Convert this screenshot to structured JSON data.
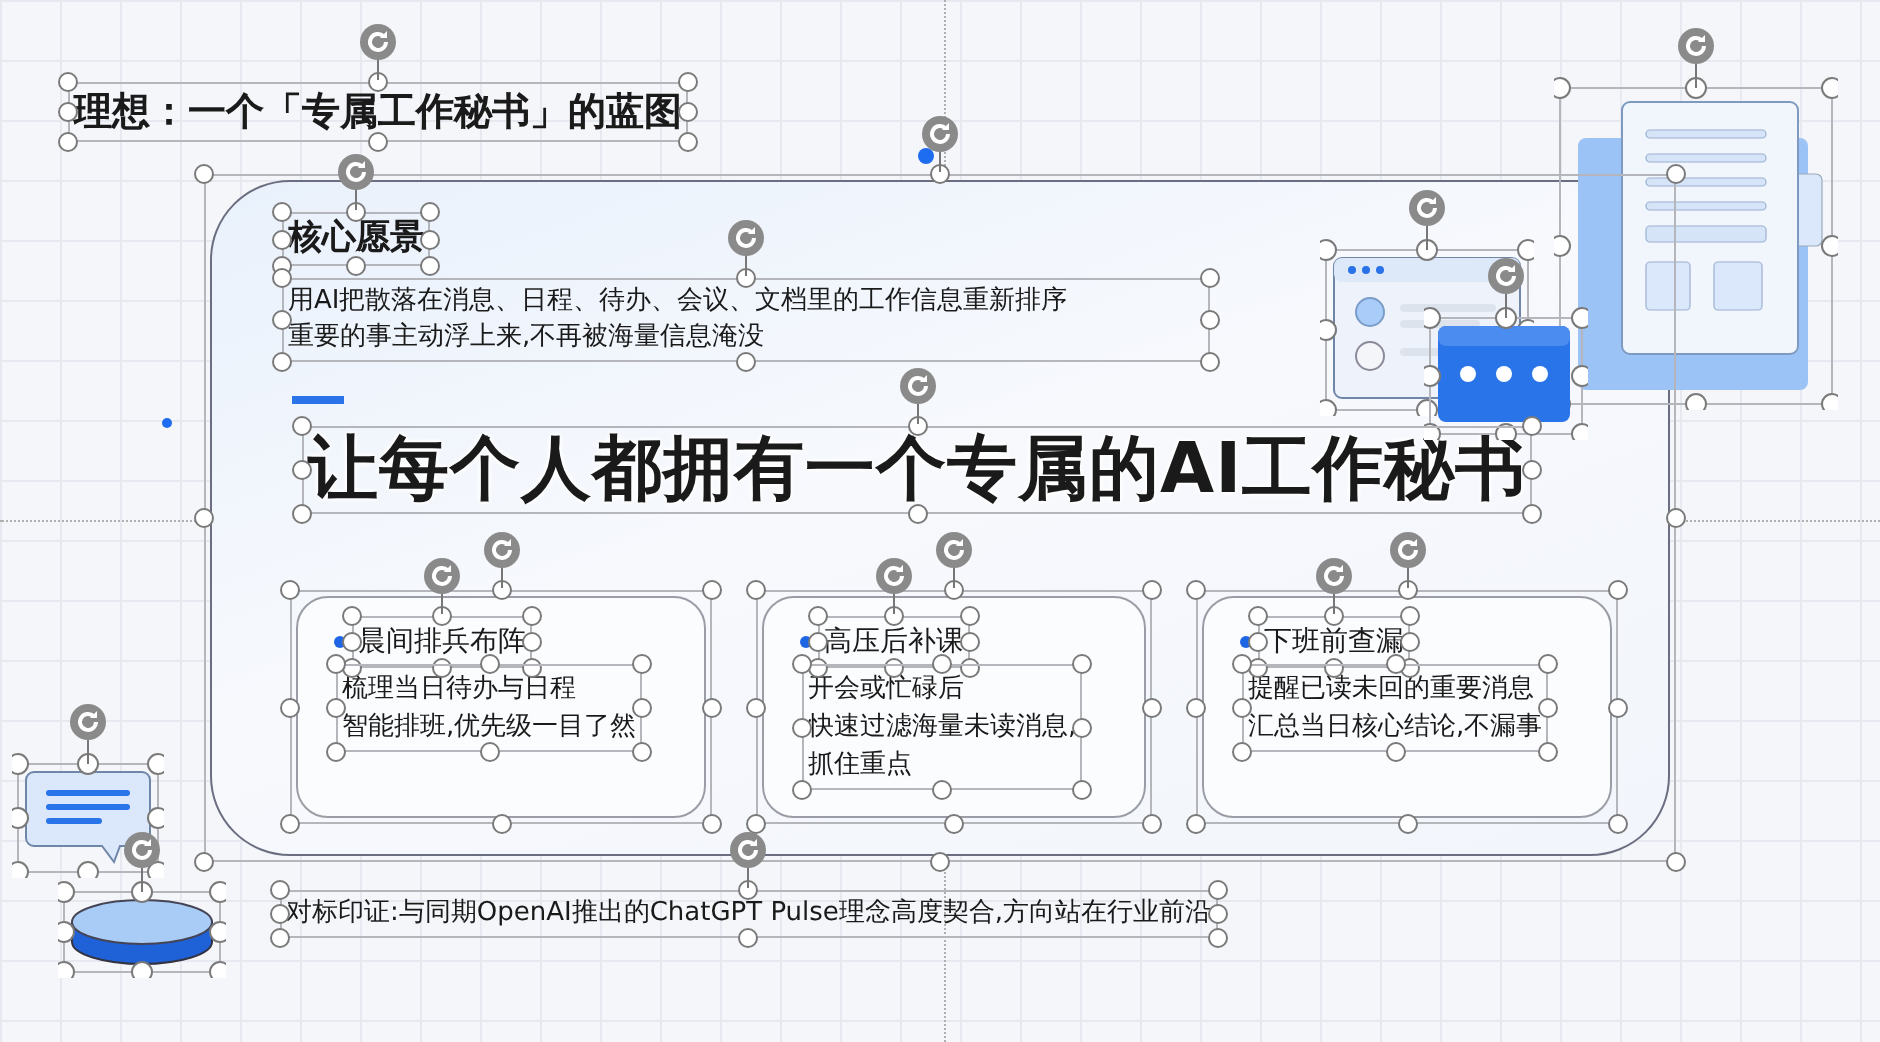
{
  "slide": {
    "title": {
      "text": "理想：一个「专属工作秘书」的蓝图",
      "selected": true
    },
    "panel": {
      "selected": true
    },
    "vision": {
      "heading": {
        "text": "核心愿景",
        "selected": true
      },
      "body": {
        "lines": [
          "用AI把散落在消息、日程、待办、会议、文档里的工作信息重新排序",
          "重要的事主动浮上来,不再被海量信息淹没"
        ],
        "selected": true
      }
    },
    "headline": {
      "text": "让每个人都拥有一个专属的AI工作秘书",
      "selected": true
    },
    "scenarios": [
      {
        "title": "晨间排兵布阵",
        "lines": [
          "梳理当日待办与日程",
          "智能排班,优先级一目了然"
        ],
        "selected": true
      },
      {
        "title": "高压后补课",
        "lines": [
          "开会或忙碌后",
          "快速过滤海量未读消息,",
          "抓住重点"
        ],
        "selected": true
      },
      {
        "title": "下班前查漏",
        "lines": [
          "提醒已读未回的重要消息",
          "汇总当日核心结论,不漏事"
        ],
        "selected": true
      }
    ],
    "footnote": {
      "text": "对标印证:与同期OpenAI推出的ChatGPT Pulse理念高度契合,方向站在行业前沿",
      "selected": true
    },
    "illustrations": [
      {
        "kind": "document",
        "selected": true
      },
      {
        "kind": "browser",
        "selected": true
      },
      {
        "kind": "message",
        "selected": true
      },
      {
        "kind": "chat",
        "selected": true
      },
      {
        "kind": "disc",
        "selected": true
      }
    ]
  }
}
